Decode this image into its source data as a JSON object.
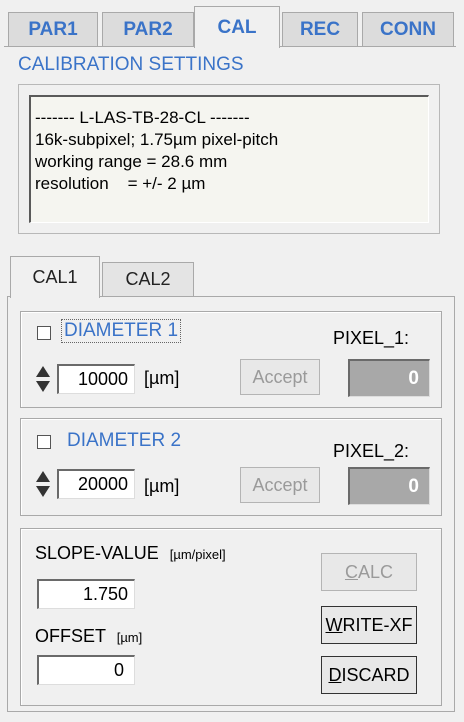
{
  "top_tabs": [
    {
      "label": "PAR1",
      "active": false
    },
    {
      "label": "PAR2",
      "active": false
    },
    {
      "label": "CAL",
      "active": true
    },
    {
      "label": "REC",
      "active": false
    },
    {
      "label": "CONN",
      "active": false
    }
  ],
  "heading": "CALIBRATION SETTINGS",
  "info": {
    "line1": "------- L-LAS-TB-28-CL -------",
    "line2": "16k-subpixel;  1.75µm pixel-pitch",
    "line3": "working range = 28.6 mm",
    "line4": "resolution    = +/- 2 µm"
  },
  "sub_tabs": [
    {
      "label": "CAL1",
      "active": true
    },
    {
      "label": "CAL2",
      "active": false
    }
  ],
  "diameter1": {
    "label": "DIAMETER 1",
    "checked": false,
    "value": "10000",
    "unit": "[µm]",
    "accept": "Accept",
    "pixel_label": "PIXEL_1:",
    "pixel_value": "0"
  },
  "diameter2": {
    "label": "DIAMETER 2",
    "checked": false,
    "value": "20000",
    "unit": "[µm]",
    "accept": "Accept",
    "pixel_label": "PIXEL_2:",
    "pixel_value": "0"
  },
  "slope": {
    "label": "SLOPE-VALUE",
    "unit": "[µm/pixel]",
    "value": "1.750"
  },
  "offset": {
    "label": "OFFSET",
    "unit": "[µm]",
    "value": "0"
  },
  "buttons": {
    "calc_u": "C",
    "calc_rest": "ALC",
    "write_u": "W",
    "write_rest": "RITE-XF",
    "discard_u": "D",
    "discard_rest": "ISCARD"
  },
  "colors": {
    "accent": "#3a73c8",
    "panel_bg": "#f0f0f0",
    "disabled": "#a8a8a8"
  }
}
